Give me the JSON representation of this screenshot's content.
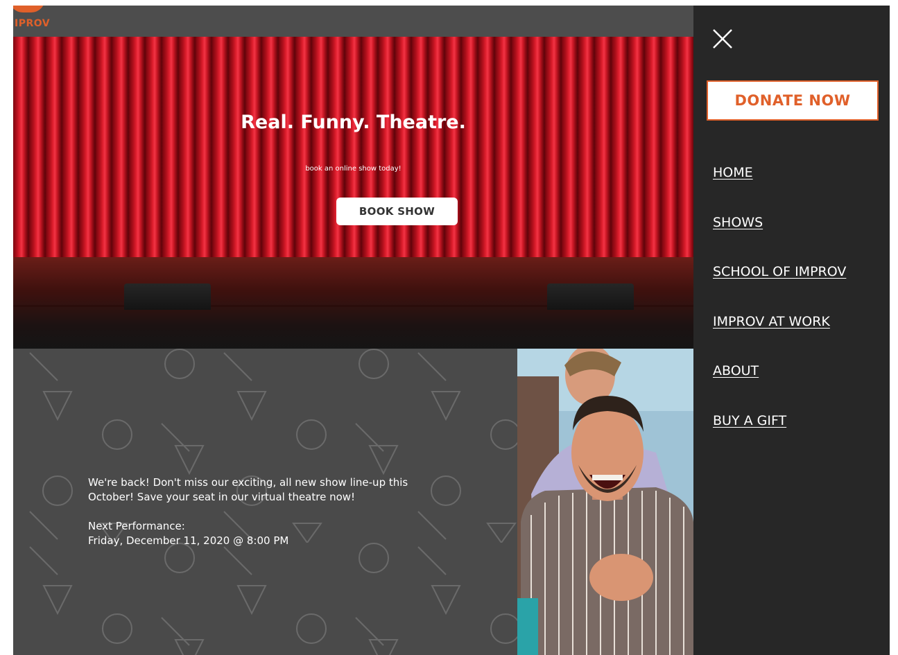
{
  "logo": {
    "text": "IPROV",
    "color": "#e0602a"
  },
  "hero": {
    "title": "Real. Funny. Theatre.",
    "subtitle": "book an online show today!",
    "cta_label": "BOOK SHOW"
  },
  "promo": {
    "paragraph": "We're back! Don't miss our exciting, all new show line-up this October! Save your seat in our virtual theatre now!",
    "next_label": "Next Performance:",
    "next_date": "Friday, December 11, 2020 @ 8:00 PM"
  },
  "drawer": {
    "close_icon": "close-x-icon",
    "donate_label": "DONATE NOW",
    "nav": [
      {
        "label": "HOME"
      },
      {
        "label": "SHOWS"
      },
      {
        "label": "SCHOOL OF IMPROV"
      },
      {
        "label": "IMPROV AT WORK"
      },
      {
        "label": "ABOUT"
      },
      {
        "label": "BUY A GIFT"
      }
    ]
  },
  "colors": {
    "accent": "#e0602a",
    "drawer_bg": "#272727",
    "section_bg": "#4a4a4a",
    "curtain_red": "#dc1d2c"
  }
}
